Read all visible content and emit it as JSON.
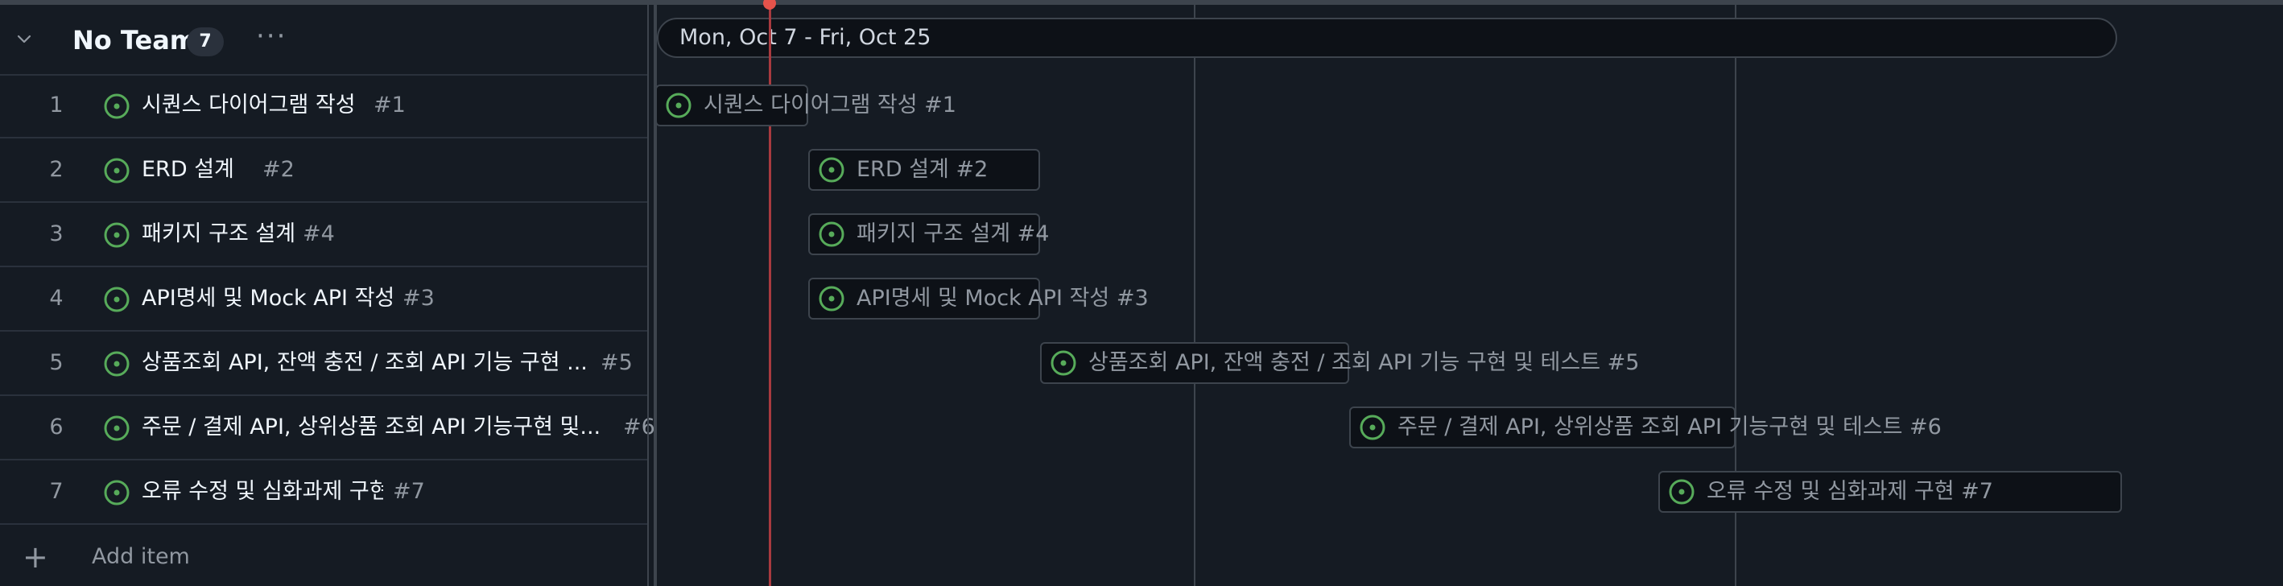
{
  "group": {
    "title": "No Team",
    "count": "7",
    "more_icon": "ellipsis-icon",
    "collapse_icon": "chevron-down-icon"
  },
  "items": [
    {
      "num": "1",
      "title": "시퀀스 다이어그램 작성",
      "number": "#1",
      "bar_label": "시퀀스 다이어그램 작성 #1"
    },
    {
      "num": "2",
      "title": "ERD 설계",
      "number": "#2",
      "bar_label": "ERD 설계 #2"
    },
    {
      "num": "3",
      "title": "패키지 구조 설계",
      "number": "#4",
      "bar_label": "패키지 구조 설계 #4"
    },
    {
      "num": "4",
      "title": "API명세 및 Mock API 작성",
      "number": "#3",
      "bar_label": "API명세 및 Mock API 작성 #3"
    },
    {
      "num": "5",
      "title": "상품조회 API, 잔액 충전 / 조회 API 기능 구현 ...",
      "number": "#5",
      "bar_label": "상품조회 API, 잔액 충전 / 조회 API 기능 구현 및 테스트 #5"
    },
    {
      "num": "6",
      "title": "주문 / 결제 API, 상위상품 조회 API 기능구현 및...",
      "number": "#6",
      "bar_label": "주문 / 결제 API, 상위상품 조회 API 기능구현 및 테스트 #6"
    },
    {
      "num": "7",
      "title": "오류 수정 및 심화과제 구현",
      "number": "#7",
      "bar_label": "오류 수정 및 심화과제 구현 #7"
    }
  ],
  "add_item": {
    "label": "Add item",
    "icon": "plus-icon"
  },
  "timeline": {
    "range_label": "Mon, Oct 7 - Fri, Oct 25",
    "today_marker": "today-marker"
  },
  "colors": {
    "open_issue": "#57ab5a",
    "today": "#e5534b",
    "background": "#151b23",
    "bar_background": "#0d1117",
    "border": "#3d444d"
  }
}
